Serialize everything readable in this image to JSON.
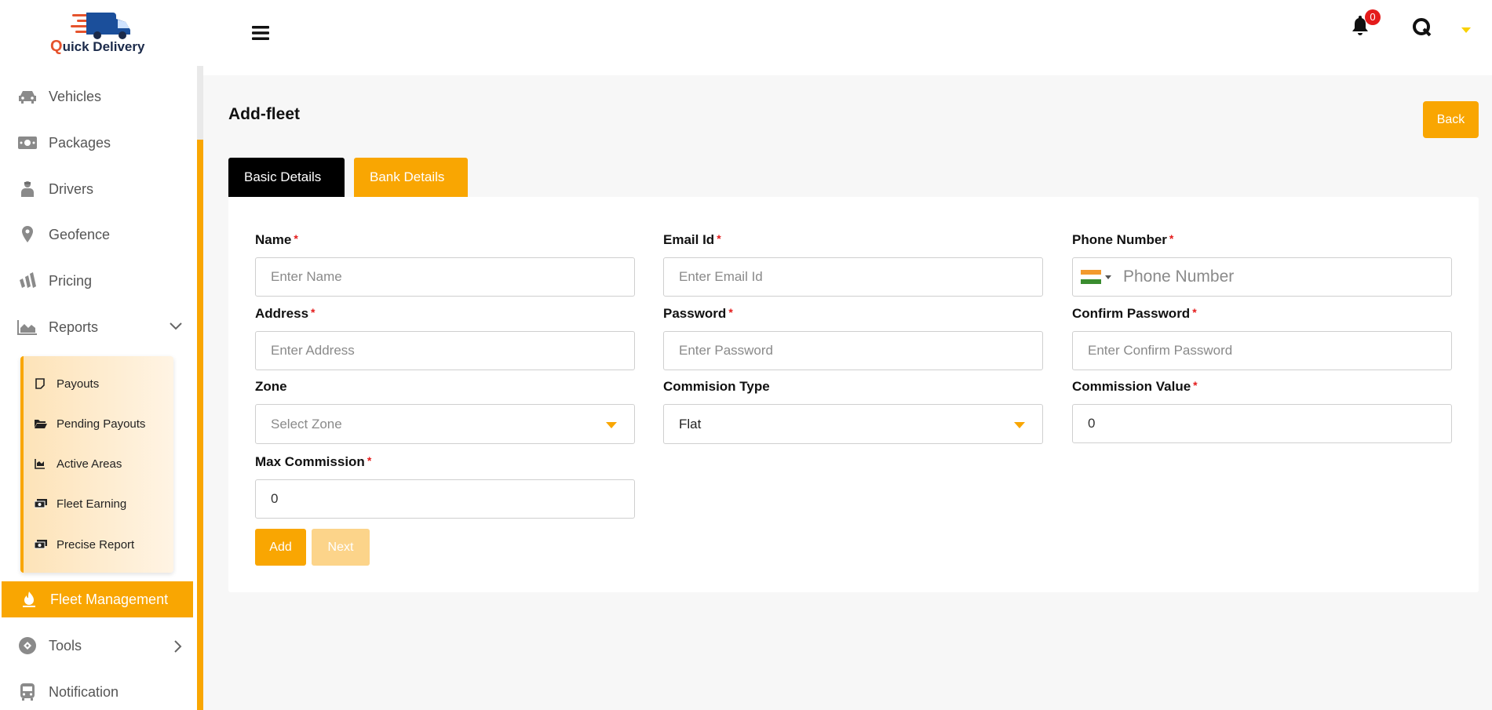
{
  "brand": {
    "name_prefix": "Q",
    "name_rest": "uick Delivery"
  },
  "sidebar": {
    "items": [
      {
        "label": "Vehicles",
        "icon": "car-icon"
      },
      {
        "label": "Packages",
        "icon": "money-icon"
      },
      {
        "label": "Drivers",
        "icon": "driver-icon"
      },
      {
        "label": "Geofence",
        "icon": "map-pin-icon"
      },
      {
        "label": "Pricing",
        "icon": "pricing-icon"
      },
      {
        "label": "Reports",
        "icon": "chart-area-icon"
      },
      {
        "label": "Fleet Management",
        "icon": "fleet-icon"
      },
      {
        "label": "Tools",
        "icon": "tools-icon"
      },
      {
        "label": "Notification",
        "icon": "bus-icon"
      }
    ],
    "reports_submenu": [
      {
        "label": "Payouts",
        "icon": "note-icon"
      },
      {
        "label": "Pending Payouts",
        "icon": "folder-open-icon"
      },
      {
        "label": "Active Areas",
        "icon": "chart-line-icon"
      },
      {
        "label": "Fleet Earning",
        "icon": "cash-icon"
      },
      {
        "label": "Precise Report",
        "icon": "cash-icon"
      }
    ],
    "active_item": "Fleet Management"
  },
  "header": {
    "notification_count": "0"
  },
  "page": {
    "title": "Add-fleet",
    "back_label": "Back",
    "tabs": [
      {
        "label": "Basic Details",
        "active": true
      },
      {
        "label": "Bank Details",
        "active": false
      }
    ]
  },
  "form": {
    "name": {
      "label": "Name",
      "required": "*",
      "placeholder": "Enter Name"
    },
    "email": {
      "label": "Email Id",
      "required": "*",
      "placeholder": "Enter Email Id"
    },
    "phone": {
      "label": "Phone Number",
      "required": "*",
      "placeholder": "Phone Number"
    },
    "address": {
      "label": "Address",
      "required": "*",
      "placeholder": "Enter Address"
    },
    "password": {
      "label": "Password",
      "required": "*",
      "placeholder": "Enter Password"
    },
    "confirm_password": {
      "label": "Confirm Password",
      "required": "*",
      "placeholder": "Enter Confirm Password"
    },
    "zone": {
      "label": "Zone",
      "placeholder": "Select Zone"
    },
    "commission_type": {
      "label": "Commision Type",
      "value": "Flat"
    },
    "commission_value": {
      "label": "Commission Value",
      "required": "*",
      "value": "0"
    },
    "max_commission": {
      "label": "Max Commission",
      "required": "*",
      "value": "0"
    },
    "add_label": "Add",
    "next_label": "Next"
  },
  "colors": {
    "accent": "#f9a602",
    "tab_active": "#000000",
    "required": "#e41b1b"
  }
}
